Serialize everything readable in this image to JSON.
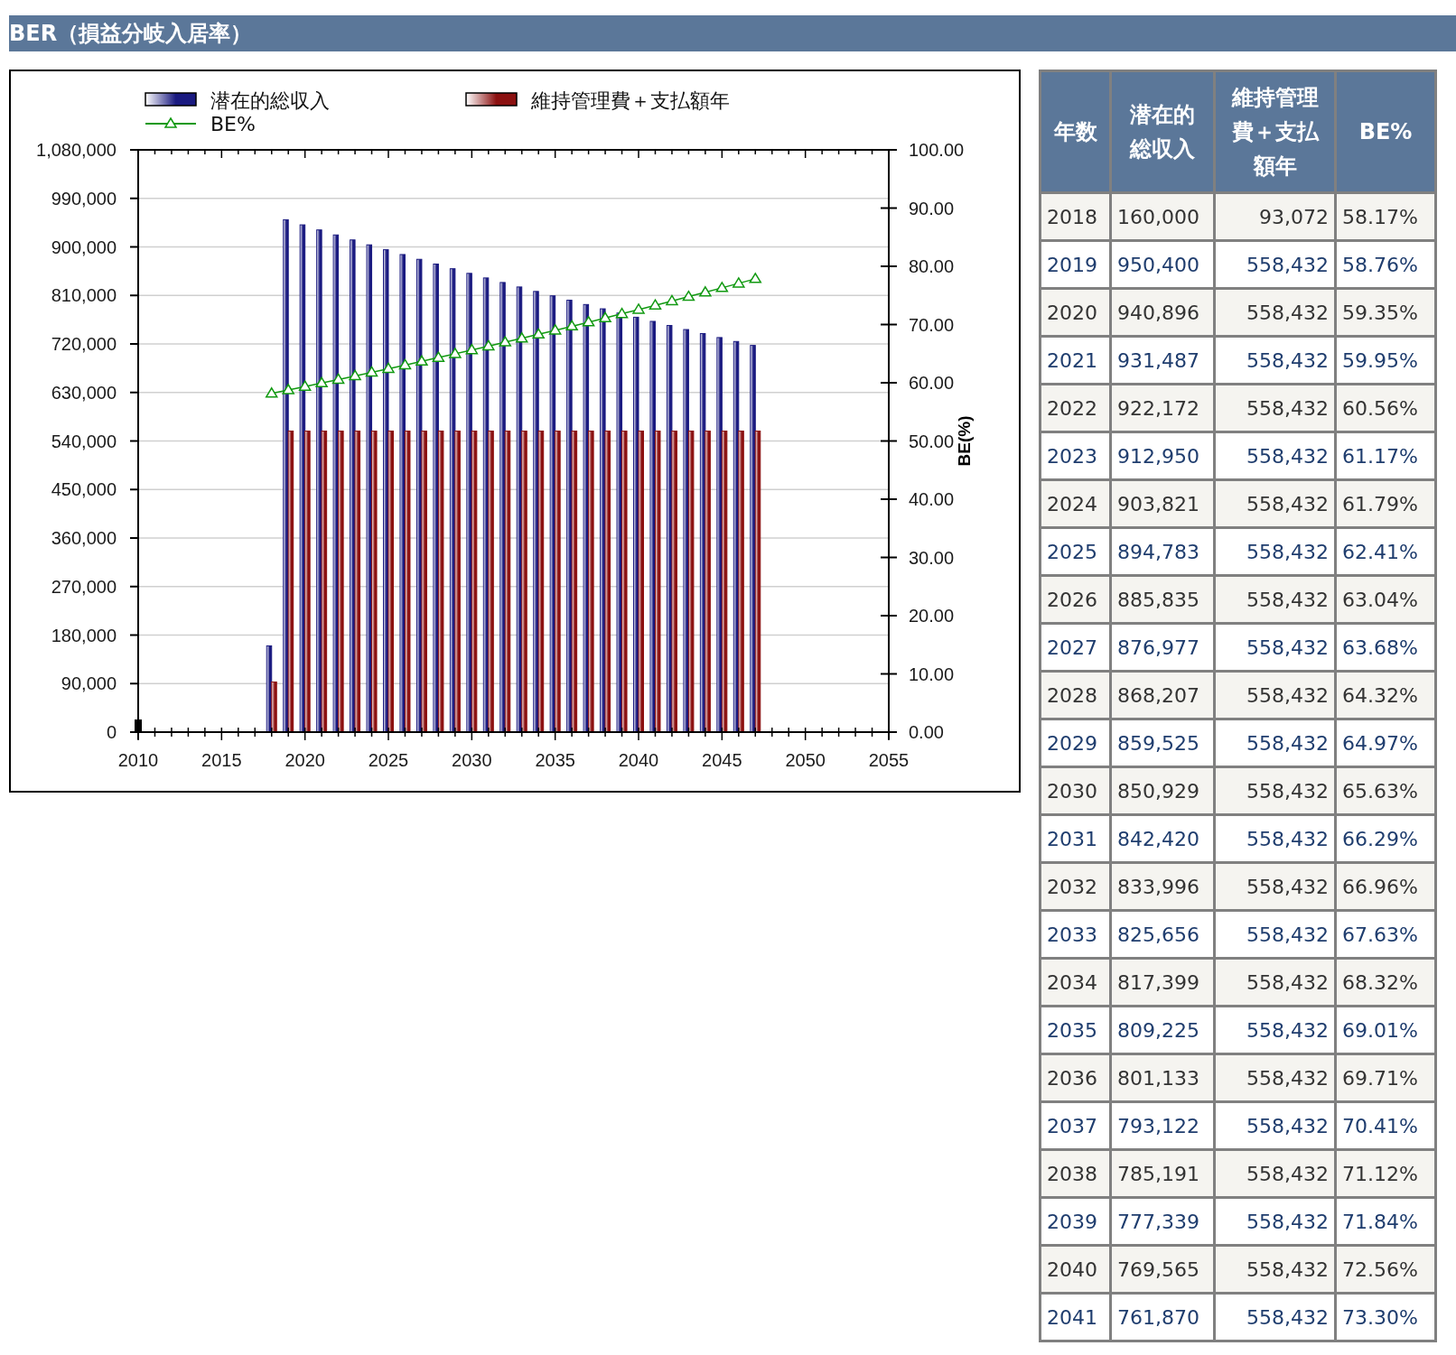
{
  "title": "BER（損益分岐入居率）",
  "chart": {
    "chart_data": {
      "type": "bar",
      "stacked": false,
      "grid": true,
      "legend": "top",
      "x": [
        2018,
        2019,
        2020,
        2021,
        2022,
        2023,
        2024,
        2025,
        2026,
        2027,
        2028,
        2029,
        2030,
        2031,
        2032,
        2033,
        2034,
        2035,
        2036,
        2037,
        2038,
        2039,
        2040,
        2041,
        2042,
        2043,
        2044,
        2045,
        2046,
        2047
      ],
      "xlim": [
        2010,
        2055
      ],
      "xticks": [
        2010,
        2015,
        2020,
        2025,
        2030,
        2035,
        2040,
        2045,
        2050,
        2055
      ],
      "ylim": [
        0,
        1080000
      ],
      "yticks": [
        {
          "value": 0,
          "label": "0"
        },
        {
          "value": 90000,
          "label": "90,000"
        },
        {
          "value": 180000,
          "label": "180,000"
        },
        {
          "value": 270000,
          "label": "270,000"
        },
        {
          "value": 360000,
          "label": "360,000"
        },
        {
          "value": 450000,
          "label": "450,000"
        },
        {
          "value": 540000,
          "label": "540,000"
        },
        {
          "value": 630000,
          "label": "630,000"
        },
        {
          "value": 720000,
          "label": "720,000"
        },
        {
          "value": 810000,
          "label": "810,000"
        },
        {
          "value": 900000,
          "label": "900,000"
        },
        {
          "value": 990000,
          "label": "990,000"
        },
        {
          "value": 1080000,
          "label": "1,080,000"
        }
      ],
      "y2label": "BE(%)",
      "y2lim": [
        0,
        100
      ],
      "y2ticks": [
        {
          "value": 0,
          "label": "0.00"
        },
        {
          "value": 10,
          "label": "10.00"
        },
        {
          "value": 20,
          "label": "20.00"
        },
        {
          "value": 30,
          "label": "30.00"
        },
        {
          "value": 40,
          "label": "40.00"
        },
        {
          "value": 50,
          "label": "50.00"
        },
        {
          "value": 60,
          "label": "60.00"
        },
        {
          "value": 70,
          "label": "70.00"
        },
        {
          "value": 80,
          "label": "80.00"
        },
        {
          "value": 90,
          "label": "90.00"
        },
        {
          "value": 100,
          "label": "100.00"
        }
      ],
      "series": [
        {
          "name": "潜在的総収入",
          "type": "bar",
          "color": "#1a1a80",
          "values": [
            160000,
            950400,
            940896,
            931487,
            922172,
            912950,
            903821,
            894783,
            885835,
            876977,
            868207,
            859525,
            850929,
            842420,
            833996,
            825656,
            817399,
            809225,
            801133,
            793122,
            785191,
            777339,
            769565,
            761870,
            754251,
            746709,
            739242,
            731849,
            724531,
            717286
          ]
        },
        {
          "name": "維持管理費＋支払額年",
          "type": "bar",
          "color": "#8b1010",
          "values": [
            93072,
            558432,
            558432,
            558432,
            558432,
            558432,
            558432,
            558432,
            558432,
            558432,
            558432,
            558432,
            558432,
            558432,
            558432,
            558432,
            558432,
            558432,
            558432,
            558432,
            558432,
            558432,
            558432,
            558432,
            558432,
            558432,
            558432,
            558432,
            558432,
            558432
          ]
        },
        {
          "name": "BE%",
          "type": "line",
          "axis": "y2",
          "marker": "triangle",
          "color": "#119911",
          "values": [
            58.17,
            58.76,
            59.35,
            59.95,
            60.56,
            61.17,
            61.79,
            62.41,
            63.04,
            63.68,
            64.32,
            64.97,
            65.63,
            66.29,
            66.96,
            67.63,
            68.32,
            69.01,
            69.71,
            70.41,
            71.12,
            71.84,
            72.56,
            73.3,
            74.04,
            74.79,
            75.54,
            76.3,
            77.07,
            77.85
          ]
        }
      ]
    }
  },
  "table": {
    "columns": [
      "年数",
      "潜在的総収入",
      "維持管理費＋支払額年",
      "BE%"
    ],
    "rows": [
      [
        "2018",
        "160,000",
        "93,072",
        "58.17%"
      ],
      [
        "2019",
        "950,400",
        "558,432",
        "58.76%"
      ],
      [
        "2020",
        "940,896",
        "558,432",
        "59.35%"
      ],
      [
        "2021",
        "931,487",
        "558,432",
        "59.95%"
      ],
      [
        "2022",
        "922,172",
        "558,432",
        "60.56%"
      ],
      [
        "2023",
        "912,950",
        "558,432",
        "61.17%"
      ],
      [
        "2024",
        "903,821",
        "558,432",
        "61.79%"
      ],
      [
        "2025",
        "894,783",
        "558,432",
        "62.41%"
      ],
      [
        "2026",
        "885,835",
        "558,432",
        "63.04%"
      ],
      [
        "2027",
        "876,977",
        "558,432",
        "63.68%"
      ],
      [
        "2028",
        "868,207",
        "558,432",
        "64.32%"
      ],
      [
        "2029",
        "859,525",
        "558,432",
        "64.97%"
      ],
      [
        "2030",
        "850,929",
        "558,432",
        "65.63%"
      ],
      [
        "2031",
        "842,420",
        "558,432",
        "66.29%"
      ],
      [
        "2032",
        "833,996",
        "558,432",
        "66.96%"
      ],
      [
        "2033",
        "825,656",
        "558,432",
        "67.63%"
      ],
      [
        "2034",
        "817,399",
        "558,432",
        "68.32%"
      ],
      [
        "2035",
        "809,225",
        "558,432",
        "69.01%"
      ],
      [
        "2036",
        "801,133",
        "558,432",
        "69.71%"
      ],
      [
        "2037",
        "793,122",
        "558,432",
        "70.41%"
      ],
      [
        "2038",
        "785,191",
        "558,432",
        "71.12%"
      ],
      [
        "2039",
        "777,339",
        "558,432",
        "71.84%"
      ],
      [
        "2040",
        "769,565",
        "558,432",
        "72.56%"
      ],
      [
        "2041",
        "761,870",
        "558,432",
        "73.30%"
      ]
    ]
  }
}
